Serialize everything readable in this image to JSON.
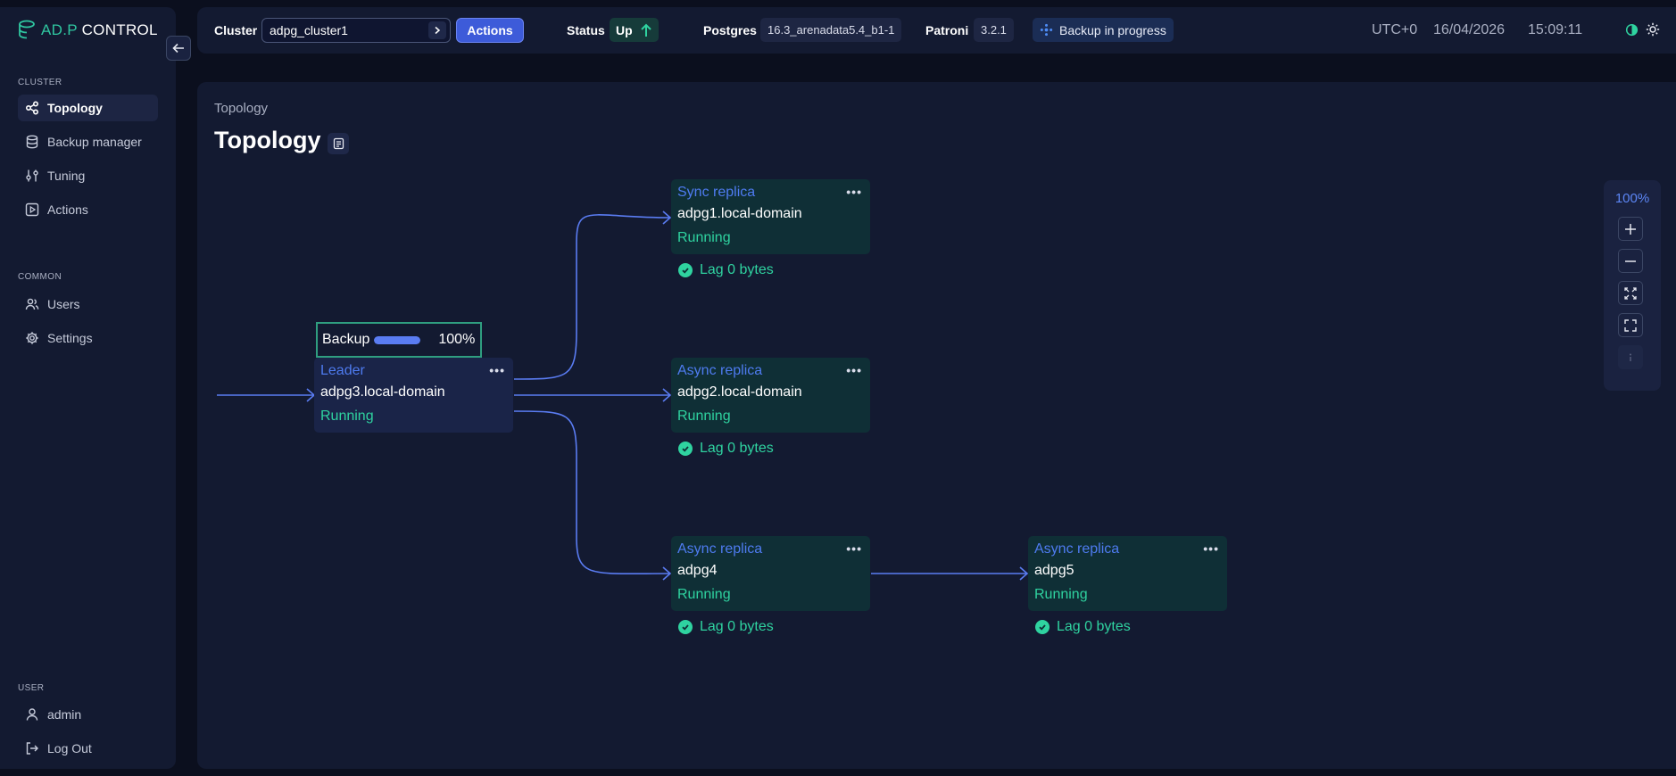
{
  "app": {
    "logo_prefix": "AD.P",
    "logo_suffix": " CONTROL"
  },
  "sidebar": {
    "sections": [
      {
        "title": "CLUSTER"
      },
      {
        "title": "COMMON"
      },
      {
        "title": "USER"
      }
    ],
    "items": [
      {
        "label": "Topology",
        "icon": "topology-icon",
        "active": true
      },
      {
        "label": "Backup manager",
        "icon": "database-icon"
      },
      {
        "label": "Tuning",
        "icon": "sliders-icon"
      },
      {
        "label": "Actions",
        "icon": "play-icon"
      },
      {
        "label": "Users",
        "icon": "users-icon"
      },
      {
        "label": "Settings",
        "icon": "gear-icon"
      },
      {
        "label": "admin",
        "icon": "user-icon"
      },
      {
        "label": "Log Out",
        "icon": "logout-icon"
      }
    ]
  },
  "header": {
    "cluster_label": "Cluster",
    "cluster_value": "adpg_cluster1",
    "actions_label": "Actions",
    "status_label": "Status",
    "status_value": "Up",
    "postgres_label": "Postgres",
    "postgres_version": "16.3_arenadata5.4_b1-1",
    "patroni_label": "Patroni",
    "patroni_version": "3.2.1",
    "backup_status": "Backup in progress",
    "timezone": "UTC+0",
    "date": "16/04/2026",
    "time": "15:09:11"
  },
  "main": {
    "breadcrumb": "Topology",
    "title": "Topology"
  },
  "topology": {
    "backup": {
      "label": "Backup",
      "progress_percent": 100,
      "progress_text": "100%"
    },
    "leader": {
      "role": "Leader",
      "host": "adpg3.local-domain",
      "state": "Running"
    },
    "replicas": [
      {
        "role": "Sync replica",
        "host": "adpg1.local-domain",
        "state": "Running",
        "lag": "Lag 0 bytes"
      },
      {
        "role": "Async replica",
        "host": "adpg2.local-domain",
        "state": "Running",
        "lag": "Lag 0 bytes"
      },
      {
        "role": "Async replica",
        "host": "adpg4",
        "state": "Running",
        "lag": "Lag 0 bytes"
      },
      {
        "role": "Async replica",
        "host": "adpg5",
        "state": "Running",
        "lag": "Lag 0 bytes"
      }
    ],
    "menu_glyph": "•••"
  },
  "zoom": {
    "level": "100%"
  },
  "colors": {
    "accent": "#3d5bd9",
    "link_blue": "#4e7bf0",
    "running_green": "#2fd3a0",
    "connector": "#5a7cf2"
  }
}
